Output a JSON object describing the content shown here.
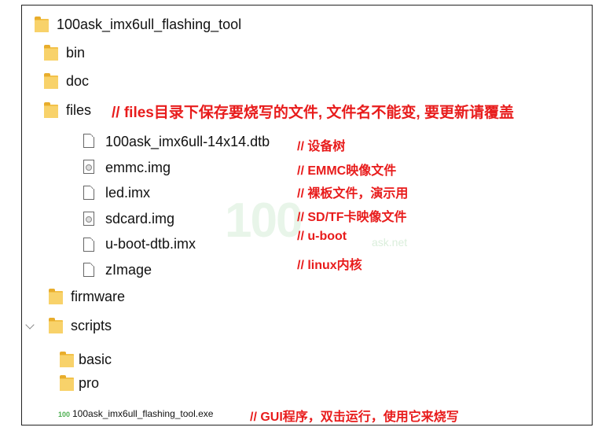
{
  "tree": {
    "root": {
      "label": "100ask_imx6ull_flashing_tool",
      "icon": "folder-icon"
    },
    "bin": {
      "label": "bin",
      "icon": "folder-icon"
    },
    "doc": {
      "label": "doc",
      "icon": "folder-icon"
    },
    "files": {
      "label": "files",
      "icon": "folder-icon",
      "note": "// files目录下保存要烧写的文件, 文件名不能变, 要更新请覆盖"
    },
    "file_items": [
      {
        "label": "100ask_imx6ull-14x14.dtb",
        "icon": "file-icon",
        "note": "// 设备树"
      },
      {
        "label": "emmc.img",
        "icon": "disk-image-icon",
        "note": "// EMMC映像文件"
      },
      {
        "label": "led.imx",
        "icon": "file-icon",
        "note": "// 裸板文件，演示用"
      },
      {
        "label": "sdcard.img",
        "icon": "disk-image-icon",
        "note": "// SD/TF卡映像文件"
      },
      {
        "label": "u-boot-dtb.imx",
        "icon": "file-icon",
        "note": "// u-boot"
      },
      {
        "label": "zImage",
        "icon": "file-icon",
        "note": "// linux内核"
      }
    ],
    "firmware": {
      "label": "firmware",
      "icon": "folder-icon"
    },
    "scripts": {
      "label": "scripts",
      "icon": "folder-icon",
      "expanded": true
    },
    "basic": {
      "label": "basic",
      "icon": "folder-icon"
    },
    "pro": {
      "label": "pro",
      "icon": "folder-icon"
    },
    "exe": {
      "label": "100ask_imx6ull_flashing_tool.exe",
      "icon_text": "100",
      "note": "// GUI程序，双击运行，使用它来烧写"
    }
  },
  "watermark": {
    "logo": "100",
    "site": "ask.net"
  },
  "colors": {
    "folder": "#f3c24a",
    "note": "#e81c1c",
    "logo": "#4caf50"
  }
}
